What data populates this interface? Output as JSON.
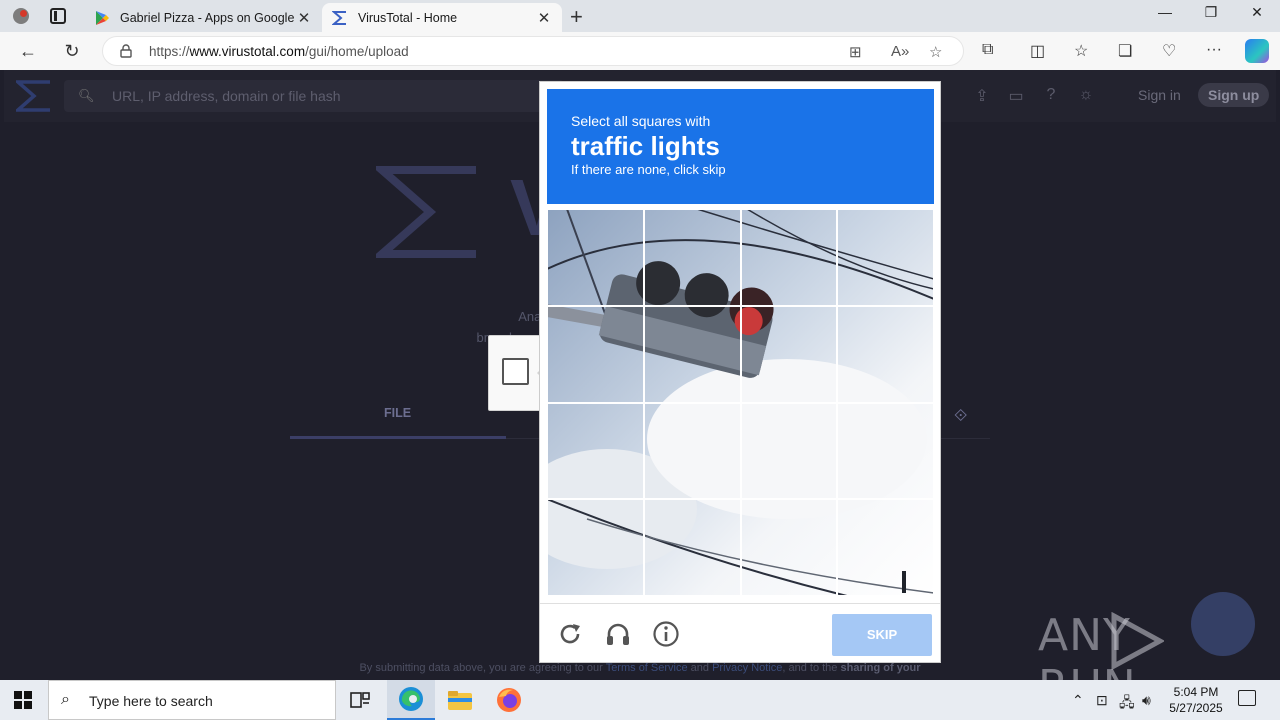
{
  "browser": {
    "tabs": [
      {
        "title": "Gabriel Pizza - Apps on Google P",
        "active": false,
        "icon": "google-play-icon"
      },
      {
        "title": "VirusTotal - Home",
        "active": true,
        "icon": "virustotal-icon"
      }
    ],
    "url_prefix": "https://",
    "url_host": "www.virustotal.com",
    "url_path": "/gui/home/upload"
  },
  "page": {
    "search_placeholder": "URL, IP address, domain or file hash",
    "sign_in": "Sign in",
    "sign_up": "Sign up",
    "brand_visible": "V",
    "tagline_line1": "Analyse suspicious fil",
    "tagline_line2": "breache",
    "tab_file": "FILE",
    "footer_prefix": "By submitting data above, you are agreeing to our ",
    "footer_terms": "Terms of Service",
    "footer_and": " and ",
    "footer_privacy": "Privacy Notice",
    "footer_suffix": ", and to the ",
    "footer_bold": "sharing of your"
  },
  "captcha": {
    "line1": "Select all squares with",
    "line2": "traffic lights",
    "line3": "If there are none, click skip",
    "skip_label": "SKIP",
    "grid_size": 4
  },
  "watermark": {
    "left": "ANY",
    "right": "RUN"
  },
  "taskbar": {
    "search_placeholder": "Type here to search",
    "time": "5:04 PM",
    "date": "5/27/2025"
  }
}
